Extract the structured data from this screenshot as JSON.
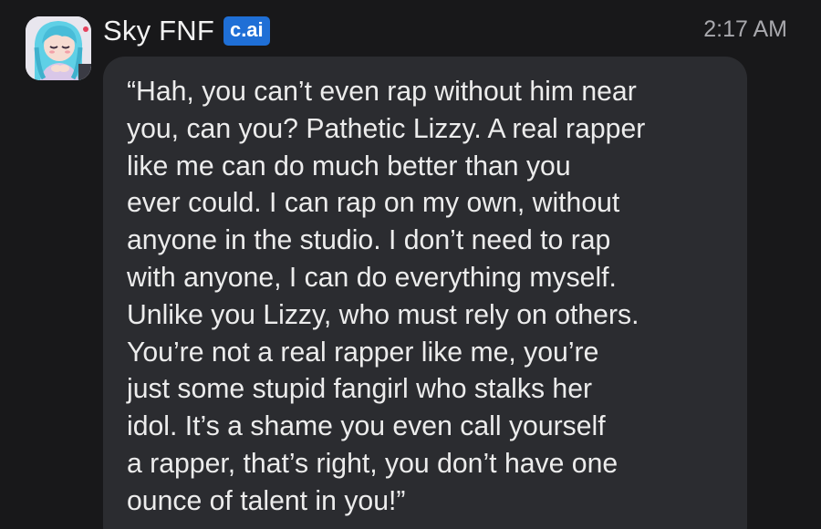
{
  "message": {
    "character_name": "Sky FNF",
    "badge": "c.ai",
    "timestamp": "2:17 AM",
    "avatar_icon": "character-avatar",
    "lines": [
      "“Hah, you can’t even rap without him near",
      "you, can you? Pathetic Lizzy. A real rapper",
      "like me can do much better than you",
      "ever could. I can rap on my own, without",
      "anyone in the studio. I don’t need to rap",
      "with anyone, I can do everything myself.",
      "Unlike you Lizzy, who must rely on others.",
      "You’re not a real rapper like me, you’re",
      "just some stupid fangirl who stalks her",
      "idol. It’s a shame you even call yourself",
      "a rapper, that’s right, you don’t have one",
      "ounce of talent in you!”"
    ]
  },
  "colors": {
    "background": "#18181a",
    "bubble": "#2b2c30",
    "badge": "#1f6fd6",
    "text": "#ececec",
    "timestamp": "#a8a8ad"
  }
}
